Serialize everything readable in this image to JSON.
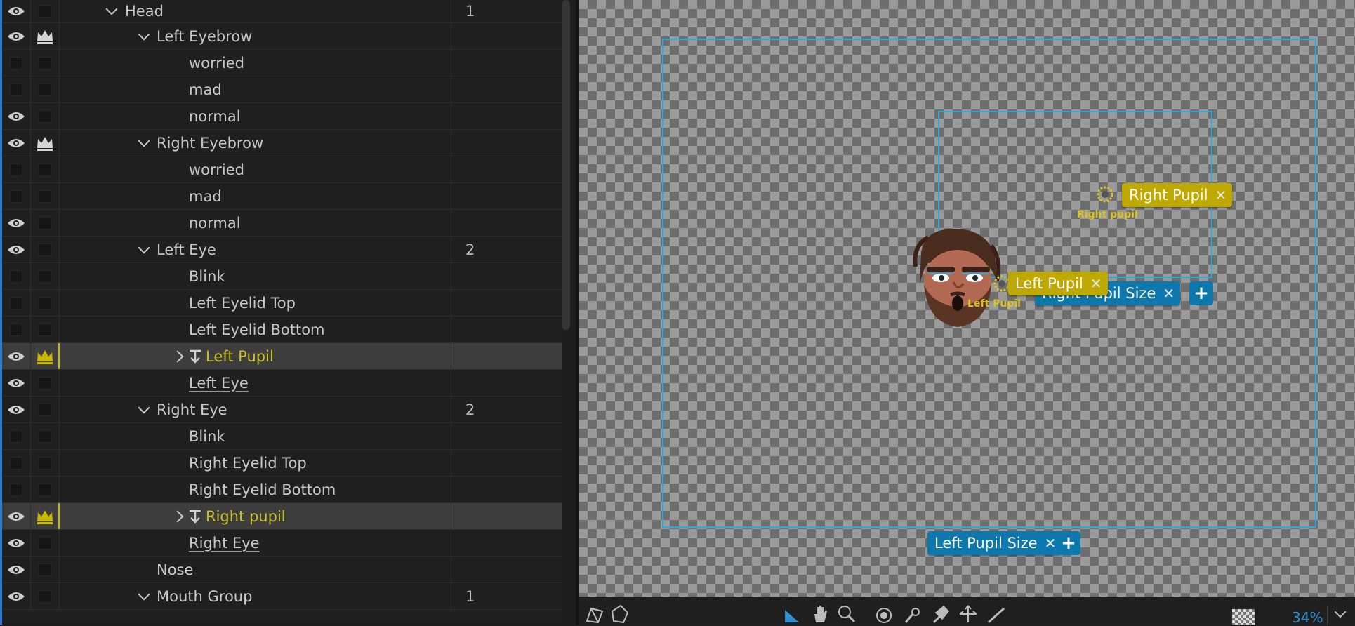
{
  "tree": {
    "rows": [
      {
        "label": "Head",
        "count": "1",
        "eye": true,
        "crown": false,
        "chevron": "down",
        "style": "normal"
      },
      {
        "label": "Left Eyebrow",
        "count": "",
        "eye": true,
        "crown": true,
        "chevron": "down",
        "style": "normal"
      },
      {
        "label": "worried",
        "count": "",
        "eye": false,
        "crown": false,
        "chevron": "none",
        "style": "normal"
      },
      {
        "label": "mad",
        "count": "",
        "eye": false,
        "crown": false,
        "chevron": "none",
        "style": "normal"
      },
      {
        "label": "normal",
        "count": "",
        "eye": true,
        "crown": false,
        "chevron": "none",
        "style": "normal"
      },
      {
        "label": "Right Eyebrow",
        "count": "",
        "eye": true,
        "crown": true,
        "chevron": "down",
        "style": "normal"
      },
      {
        "label": "worried",
        "count": "",
        "eye": false,
        "crown": false,
        "chevron": "none",
        "style": "normal"
      },
      {
        "label": "mad",
        "count": "",
        "eye": false,
        "crown": false,
        "chevron": "none",
        "style": "normal"
      },
      {
        "label": "normal",
        "count": "",
        "eye": true,
        "crown": false,
        "chevron": "none",
        "style": "normal"
      },
      {
        "label": "Left Eye",
        "count": "2",
        "eye": true,
        "crown": false,
        "chevron": "down",
        "style": "normal"
      },
      {
        "label": "Blink",
        "count": "",
        "eye": false,
        "crown": false,
        "chevron": "none",
        "style": "normal"
      },
      {
        "label": "Left Eyelid Top",
        "count": "",
        "eye": false,
        "crown": false,
        "chevron": "none",
        "style": "normal"
      },
      {
        "label": "Left Eyelid Bottom",
        "count": "",
        "eye": false,
        "crown": false,
        "chevron": "none",
        "style": "normal"
      },
      {
        "label": "Left Pupil",
        "count": "",
        "eye": true,
        "crown": true,
        "chevron": "right",
        "style": "selected"
      },
      {
        "label": "Left Eye",
        "count": "",
        "eye": true,
        "crown": false,
        "chevron": "none",
        "style": "underline"
      },
      {
        "label": "Right Eye",
        "count": "2",
        "eye": true,
        "crown": false,
        "chevron": "down",
        "style": "normal"
      },
      {
        "label": "Blink",
        "count": "",
        "eye": false,
        "crown": false,
        "chevron": "none",
        "style": "normal"
      },
      {
        "label": "Right Eyelid Top",
        "count": "",
        "eye": false,
        "crown": false,
        "chevron": "none",
        "style": "normal"
      },
      {
        "label": "Right Eyelid Bottom",
        "count": "",
        "eye": false,
        "crown": false,
        "chevron": "none",
        "style": "normal"
      },
      {
        "label": "Right pupil",
        "count": "",
        "eye": true,
        "crown": true,
        "chevron": "right",
        "style": "selected"
      },
      {
        "label": "Right Eye",
        "count": "",
        "eye": true,
        "crown": false,
        "chevron": "none",
        "style": "underline"
      },
      {
        "label": "Nose",
        "count": "",
        "eye": true,
        "crown": false,
        "chevron": "none",
        "style": "normal"
      },
      {
        "label": "Mouth Group",
        "count": "1",
        "eye": true,
        "crown": false,
        "chevron": "down",
        "style": "normal"
      }
    ]
  },
  "stage": {
    "tags": {
      "right_pupil": "Right Pupil",
      "left_pupil": "Left Pupil",
      "right_pupil_size": "Right Pupil Size",
      "left_pupil_size": "Left Pupil Size"
    },
    "handle_labels": {
      "right": "Right pupil",
      "left": "Left Pupil"
    },
    "close_glyph": "✕",
    "add_glyph": "+"
  },
  "toolbar": {
    "zoom": "34%",
    "tools": [
      "mesh-icon",
      "free-form-icon",
      "play-triangle-icon",
      "hand-icon",
      "zoom-icon",
      "origin-icon",
      "dragger-icon",
      "pin-icon",
      "transform-icon",
      "stick-icon"
    ]
  },
  "colors": {
    "accent_blue": "#2ea8e0",
    "tag_yellow": "#bfa800",
    "tag_blue": "#0c78ae",
    "crown_yellow": "#c9b800"
  }
}
